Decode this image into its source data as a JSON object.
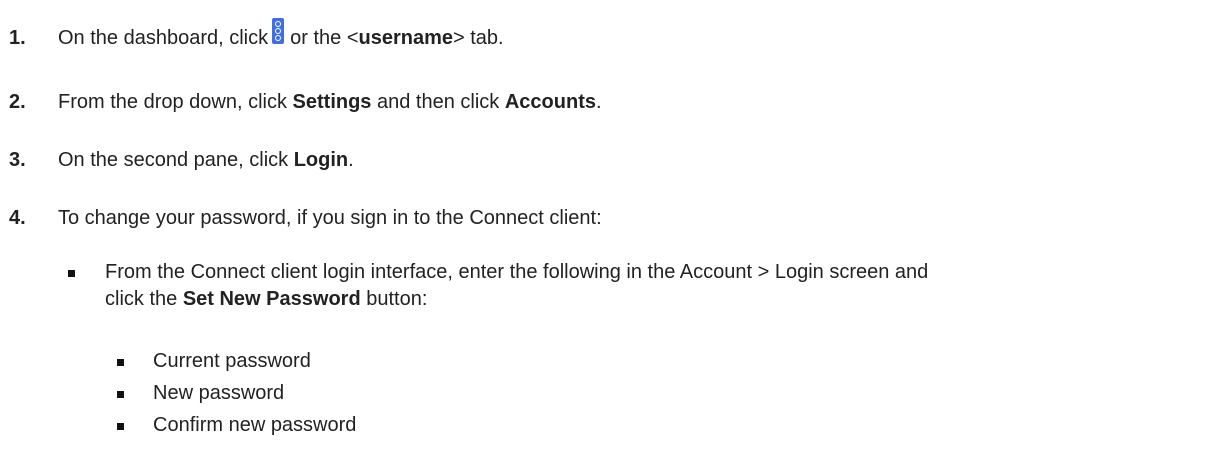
{
  "steps": [
    {
      "number": "1.",
      "text_a": "On the dashboard, click",
      "icon": "kebab-menu-icon",
      "text_b": "or the <",
      "bold": "username",
      "text_c": "> tab."
    },
    {
      "number": "2.",
      "text_a": "From the drop down, click ",
      "bold_a": "Settings",
      "text_b": " and then click ",
      "bold_b": "Accounts",
      "text_c": "."
    },
    {
      "number": "3.",
      "text_a": "On the second pane, click ",
      "bold": "Login",
      "text_b": "."
    },
    {
      "number": "4.",
      "text": "To change your password, if you sign in to the Connect client:"
    }
  ],
  "sub_item": {
    "line1": "From the Connect client login interface, enter the following in the Account > Login screen and",
    "line2_a": "click the ",
    "line2_bold": "Set New Password",
    "line2_b": " button:"
  },
  "fields": [
    "Current password",
    "New password",
    "Confirm new password"
  ],
  "colors": {
    "icon_accent": "#3f6fe0",
    "text": "#222222"
  }
}
